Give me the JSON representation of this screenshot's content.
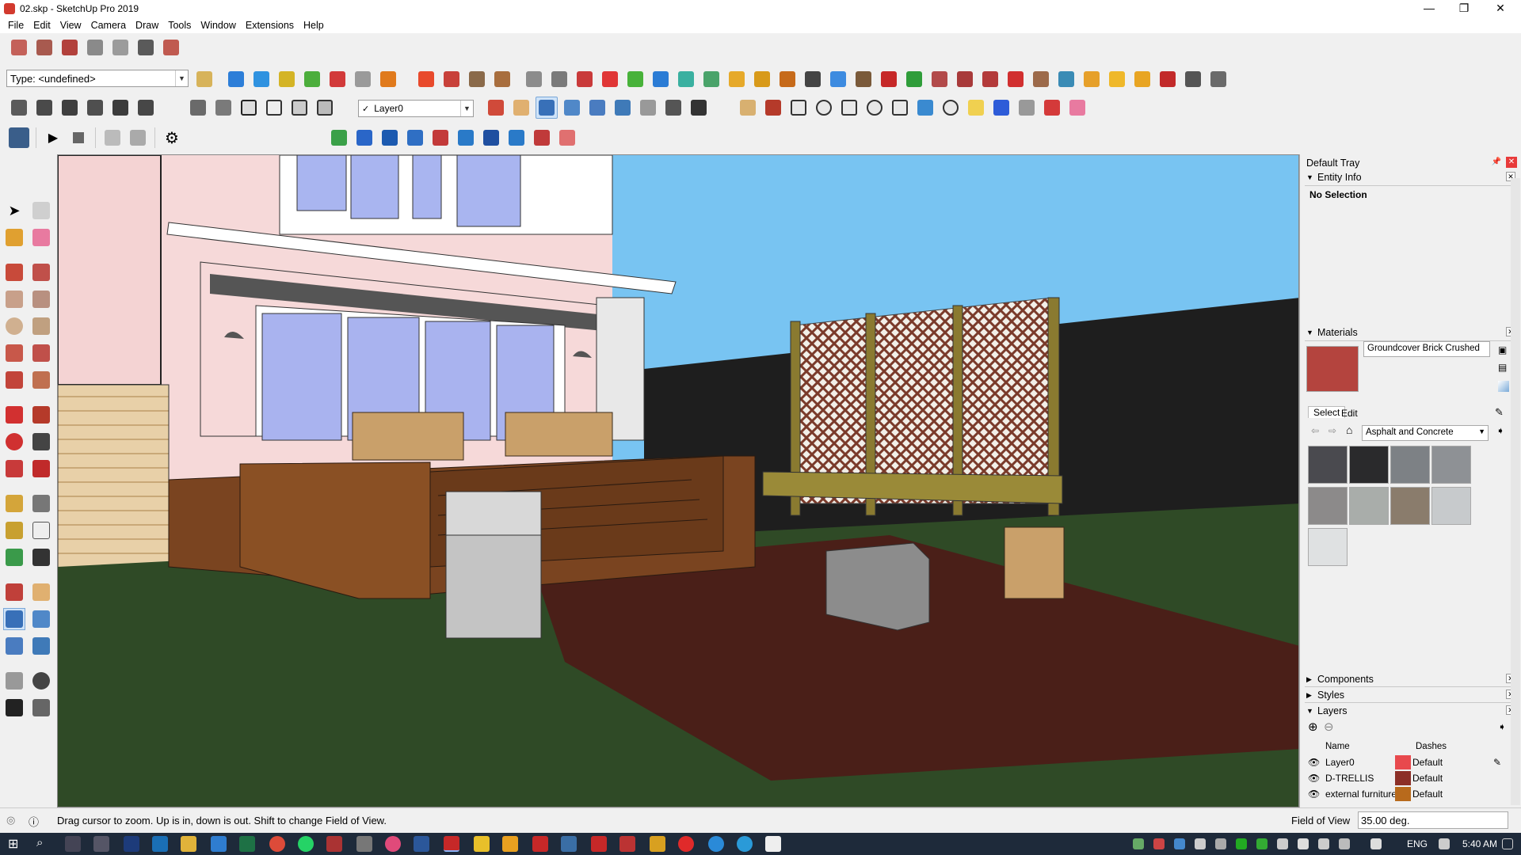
{
  "window": {
    "title": "02.skp - SketchUp Pro 2019",
    "minimize": "—",
    "maximize": "❐",
    "close": "✕"
  },
  "menu": [
    "File",
    "Edit",
    "View",
    "Camera",
    "Draw",
    "Tools",
    "Window",
    "Extensions",
    "Help"
  ],
  "toolbar": {
    "type_combo": "Type: <undefined>",
    "layer_combo": "Layer0",
    "layer_check": "✓"
  },
  "tray": {
    "title": "Default Tray",
    "entity_info": {
      "header": "Entity Info",
      "selection": "No Selection"
    },
    "materials": {
      "header": "Materials",
      "current_name": "Groundcover Brick Crushed",
      "tab_select": "Select",
      "tab_edit": "Edit",
      "library": "Asphalt and Concrete",
      "swatch_colors": [
        "#4a4a4f",
        "#2a2a2c",
        "#7d8185",
        "#8e9195",
        "#8c8a8a",
        "#a9adaa",
        "#8a7c6c",
        "#c7cacc",
        "#dfe1e2"
      ],
      "current_color": "#b4443e"
    },
    "components_header": "Components",
    "styles_header": "Styles",
    "layers": {
      "header": "Layers",
      "col_name": "Name",
      "col_dashes": "Dashes",
      "rows": [
        {
          "name": "Layer0",
          "color": "#e8494d",
          "dashes": "Default"
        },
        {
          "name": "D-TRELLIS",
          "color": "#8c2f27",
          "dashes": "Default"
        },
        {
          "name": "external furniture",
          "color": "#b86a1c",
          "dashes": "Default"
        }
      ]
    }
  },
  "status": {
    "hint": "Drag cursor to zoom.  Up is in, down is out. Shift to change Field of View.",
    "vcb_label": "Field of View",
    "vcb_value": "35.00 deg."
  },
  "taskbar": {
    "language": "ENG",
    "clock": "5:40 AM"
  }
}
